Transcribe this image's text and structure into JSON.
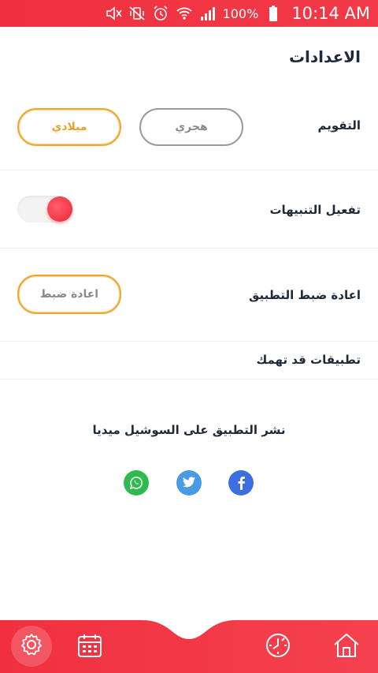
{
  "status_bar": {
    "battery": "100%",
    "time": "10:14 AM",
    "icons": [
      "mute-icon",
      "vibrate-icon",
      "alarm-icon",
      "wifi-icon",
      "signal-icon",
      "battery-icon"
    ]
  },
  "page": {
    "title": "الاعدادات"
  },
  "settings": {
    "calendar": {
      "label": "التقويم",
      "options": [
        "ميلادي",
        "هجري"
      ],
      "selected": "ميلادي"
    },
    "notifications": {
      "label": "تفعيل التنبيهات",
      "enabled": true
    },
    "reset": {
      "label": "اعادة ضبط التطبيق",
      "button_label": "اعادة ضبط"
    },
    "apps": {
      "label": "تطبيقات قد تهمك"
    }
  },
  "share": {
    "title": "نشر التطبيق على السوشيل ميديا",
    "networks": [
      "whatsapp-icon",
      "twitter-icon",
      "facebook-icon"
    ]
  },
  "nav": {
    "items": [
      "settings-icon",
      "calendar-icon",
      "clock-icon",
      "home-icon"
    ],
    "active": "settings-icon"
  },
  "colors": {
    "accent": "#f0303f",
    "gold": "#f0a532",
    "whatsapp": "#2dbb4e",
    "twitter": "#4a9be6",
    "facebook": "#3b6fe0"
  }
}
